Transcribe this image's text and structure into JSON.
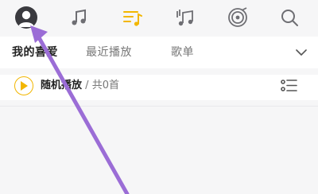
{
  "nav": {
    "icons": [
      "avatar-icon",
      "music-note-icon",
      "playlist-icon",
      "music-library-icon",
      "radio-icon",
      "search-icon"
    ],
    "active_index": 2,
    "accent_color": "#f2b600",
    "inactive_color": "#6e6e73"
  },
  "tabs": {
    "items": [
      {
        "label": "我的喜爱"
      },
      {
        "label": "最近播放"
      },
      {
        "label": "歌单"
      }
    ],
    "active_index": 0
  },
  "play_bar": {
    "label": "随机播放",
    "separator": "/",
    "count_text": "共0首"
  },
  "annotation": {
    "color": "#9b6dd6"
  }
}
